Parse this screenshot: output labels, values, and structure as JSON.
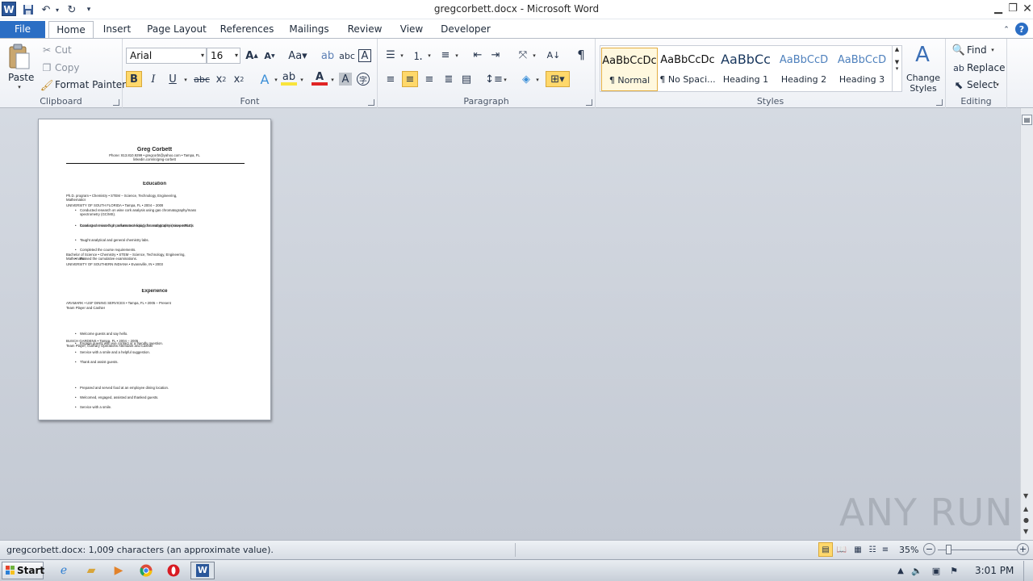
{
  "window": {
    "title": "gregcorbett.docx - Microsoft Word",
    "app_icon": "W"
  },
  "ribbon_tabs": [
    "File",
    "Home",
    "Insert",
    "Page Layout",
    "References",
    "Mailings",
    "Review",
    "View",
    "Developer"
  ],
  "clipboard": {
    "paste": "Paste",
    "cut": "Cut",
    "copy": "Copy",
    "format_painter": "Format Painter",
    "group_label": "Clipboard"
  },
  "font": {
    "name": "Arial",
    "size": "16",
    "group_label": "Font"
  },
  "paragraph": {
    "group_label": "Paragraph"
  },
  "styles": {
    "group_label": "Styles",
    "items": [
      {
        "preview": "AaBbCcDc",
        "name": "¶ Normal"
      },
      {
        "preview": "AaBbCcDc",
        "name": "¶ No Spaci..."
      },
      {
        "preview": "AaBbCc",
        "name": "Heading 1"
      },
      {
        "preview": "AaBbCcD",
        "name": "Heading 2"
      },
      {
        "preview": "AaBbCcD",
        "name": "Heading 3"
      }
    ],
    "change_styles": "Change Styles"
  },
  "editing": {
    "group_label": "Editing",
    "find": "Find",
    "replace": "Replace",
    "select": "Select"
  },
  "document": {
    "name": "Greg Corbett",
    "contact_1": "Phone: 813.810.9299 • gregcorbt@yahoo.com • Tampa, FL",
    "contact_2": "linkedin.com/in/greg-corbett",
    "education_heading": "Education",
    "edu1_line1": "Ph.D. program • Chemistry • STEM – Science, Technology, Engineering,",
    "edu1_line2": "Mathematics",
    "edu1_line3": "UNIVERSITY OF SOUTH FLORIDA • Tampa, FL • 2004 – 2009",
    "edu1_bullets": [
      "Conducted research on wine cork analysis using gas chromatography/mass",
      "spectrometry (GC/MS).",
      "Conducted research on column technology for analytical microseparations",
      "focusing on micro-high performance liquid chromatography (micro-HPLC).",
      "Taught analytical and general chemistry labs.",
      "Completed the course requirements.",
      "Passed the cumulative examinations."
    ],
    "edu2_line1": "Bachelor of Science • Chemistry • STEM – Science, Technology, Engineering,",
    "edu2_line2": "Mathematics",
    "edu2_line3": "UNIVERSITY OF SOUTHERN INDIANA • Evansville, IN • 2003",
    "experience_heading": "Experience",
    "exp1_line1": "ARAMARK • USF DINING SERVICES • Tampa, FL • 2005 – Present",
    "exp1_line2": "Team Player and Cashier",
    "exp1_bullets": [
      "Welcome guests and say hello.",
      "Engage guests with eye contact or a friendly question.",
      "Service with a smile and a helpful suggestion.",
      "Thank and assist guests."
    ],
    "exp2_line1": "BUSCH GARDENS • Tampa, FL • 2004 – 2005",
    "exp2_line2": "Team Player, Culinary Operations Attendant and Cashier",
    "exp2_bullets": [
      "Prepared and served food at an employee dining location.",
      "Welcomed, engaged, assisted and thanked guests.",
      "Service with a smile."
    ]
  },
  "status": {
    "text": "gregcorbett.docx: 1,009 characters (an approximate value).",
    "zoom": "35%",
    "zoom_level": 0.35
  },
  "taskbar": {
    "start": "Start",
    "clock": "3:01 PM"
  },
  "watermark": "ANY RUN"
}
